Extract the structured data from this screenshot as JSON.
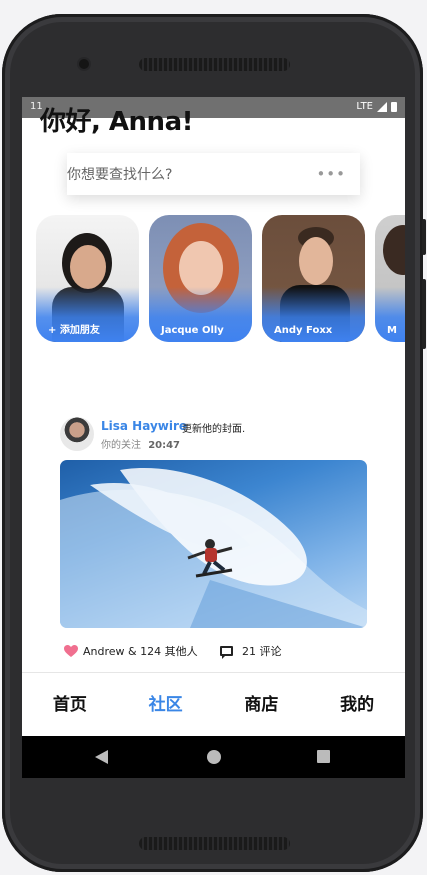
{
  "status_bar": {
    "time": "11",
    "network": "LTE"
  },
  "greeting": "你好, Anna!",
  "search": {
    "placeholder": "你想要查找什么?",
    "menu_glyph": "•••"
  },
  "stories": [
    {
      "label": "+ 添加朋友"
    },
    {
      "label": "Jacque Olly"
    },
    {
      "label": "Andy Foxx"
    },
    {
      "label": "M"
    }
  ],
  "post": {
    "author": "Lisa Haywire",
    "action": "更新他的封面.",
    "relation": "你的关注",
    "time": "20:47",
    "likes": "Andrew & 124 其他人",
    "comments": "21 评论"
  },
  "tabs": [
    {
      "label": "首页",
      "active": false
    },
    {
      "label": "社区",
      "active": true
    },
    {
      "label": "商店",
      "active": false
    },
    {
      "label": "我的",
      "active": false
    }
  ],
  "colors": {
    "accent": "#3a86e6",
    "heart": "#f06f8f",
    "story_gradient": "#3f82f0"
  },
  "icons": [
    "signal-icon",
    "battery-icon",
    "more-dots-icon",
    "heart-icon",
    "comment-icon",
    "back-icon",
    "home-icon",
    "recents-icon"
  ]
}
